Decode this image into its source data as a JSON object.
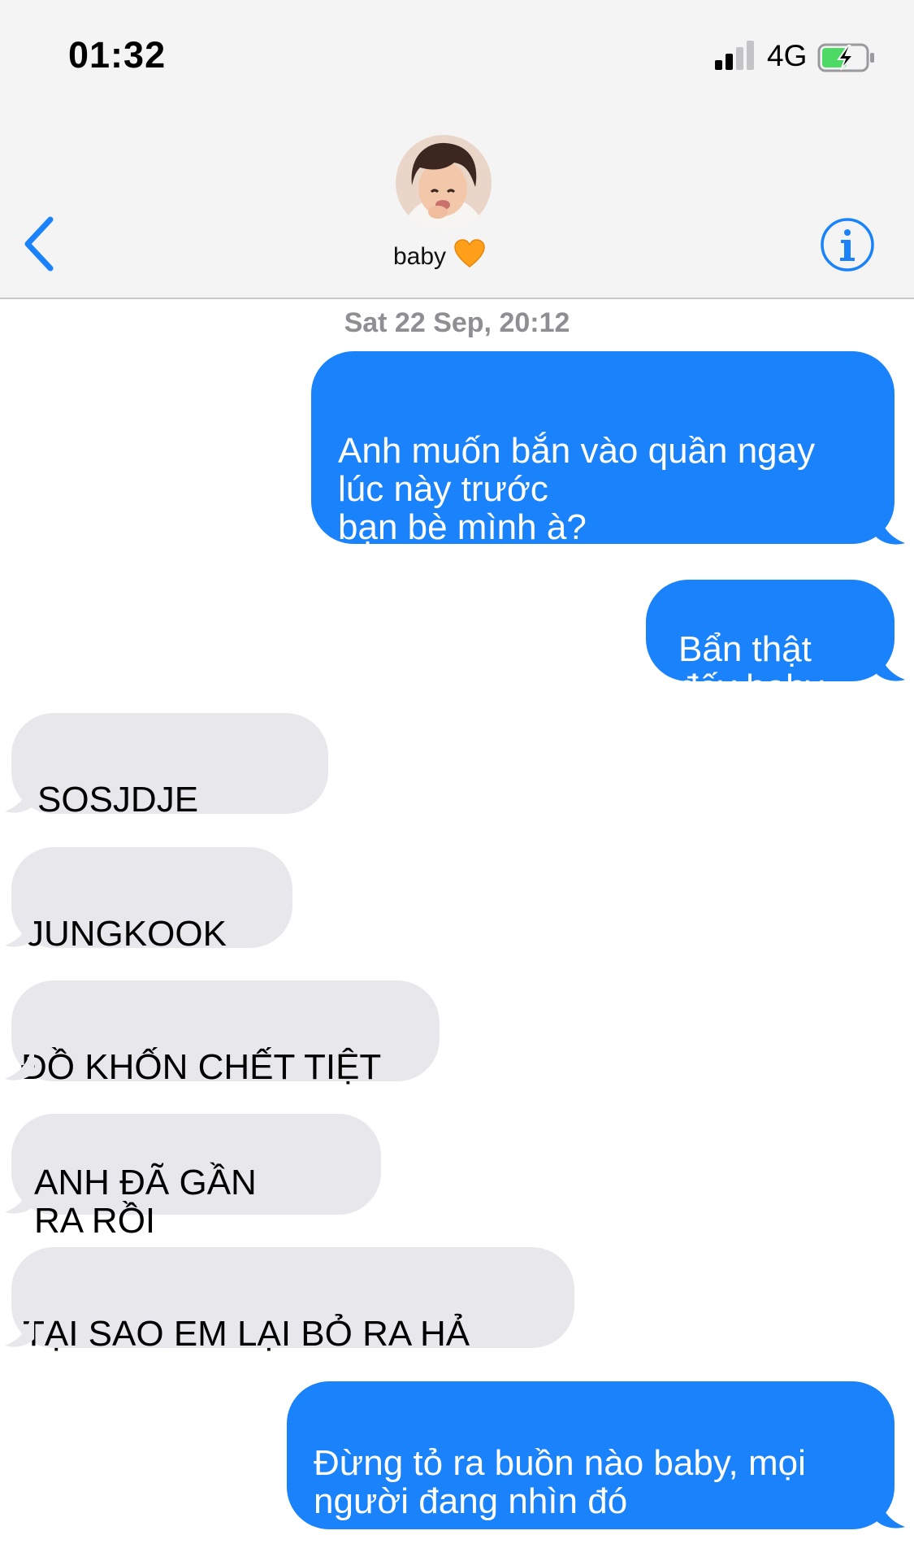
{
  "status_bar": {
    "time": "01:32",
    "network": "4G",
    "battery_state": "charging",
    "signal_bars_active": 2,
    "signal_bars_total": 4
  },
  "nav": {
    "back_icon": "chevron-left-icon",
    "contact_name": "baby",
    "contact_emoji": "🧡",
    "info_icon": "info-circle-icon",
    "accent_color": "#1a82fb"
  },
  "conversation": {
    "timestamp": "Sat 22 Sep, 20:12",
    "messages": [
      {
        "direction": "outgoing",
        "text": "Anh muốn bắn vào quần ngay\nlúc này trước\nbạn bè mình à?"
      },
      {
        "direction": "outgoing",
        "text": "Bẩn thật\nđấy baby"
      },
      {
        "direction": "incoming",
        "text": "SOSJDJE"
      },
      {
        "direction": "incoming",
        "text": "JUNGKOOK"
      },
      {
        "direction": "incoming",
        "text": "ĐỒ KHỐN CHẾT TIỆT"
      },
      {
        "direction": "incoming",
        "text": "ANH ĐÃ GẦN\nRA RỒI"
      },
      {
        "direction": "incoming",
        "text": "TẠI SAO EM LẠI BỎ RA HẢ"
      },
      {
        "direction": "outgoing",
        "text": "Đừng tỏ ra buồn nào baby, mọi\nngười đang nhìn đó"
      }
    ]
  },
  "colors": {
    "outgoing_bubble": "#1a82fb",
    "incoming_bubble": "#e8e8ec",
    "header_background": "#f4f4f5",
    "timestamp_text": "#8e8e93"
  }
}
